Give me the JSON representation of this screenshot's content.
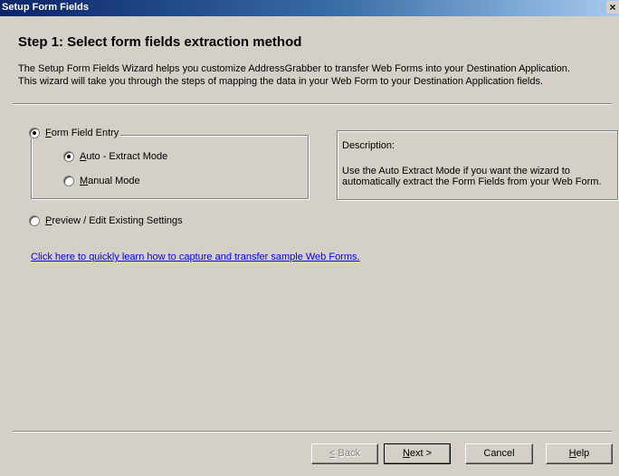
{
  "window": {
    "title": "Setup Form Fields",
    "close_glyph": "×"
  },
  "step": {
    "title": "Step 1:  Select form fields extraction method"
  },
  "intro": {
    "line1": "The Setup Form Fields Wizard helps you customize AddressGrabber to transfer Web Forms into your Destination Application.",
    "line2": "This wizard will take you through the steps of mapping the data in your Web Form to your Destination Application fields."
  },
  "options": {
    "form_field_entry": {
      "label": "Form Field Entry",
      "checked": true
    },
    "auto_extract": {
      "label": "Auto - Extract Mode",
      "checked": true
    },
    "manual_mode": {
      "label": "Manual Mode",
      "checked": false
    },
    "preview_edit": {
      "label": "Preview / Edit Existing Settings",
      "checked": false
    }
  },
  "description": {
    "label": "Description:",
    "line1": "Use the Auto Extract Mode if you want the wizard to",
    "line2": "automatically extract the Form Fields from your Web Form."
  },
  "link": {
    "text": "Click here to quickly learn how to capture and transfer sample Web Forms."
  },
  "buttons": {
    "back": "< Back",
    "next": "Next >",
    "cancel": "Cancel",
    "help": "Help"
  },
  "colors": {
    "dialog_bg": "#d4d0c8",
    "title_bar": "#0a246a",
    "link": "#0000ff"
  },
  "icons": {
    "close": "close-icon",
    "radio": "radio-button"
  }
}
